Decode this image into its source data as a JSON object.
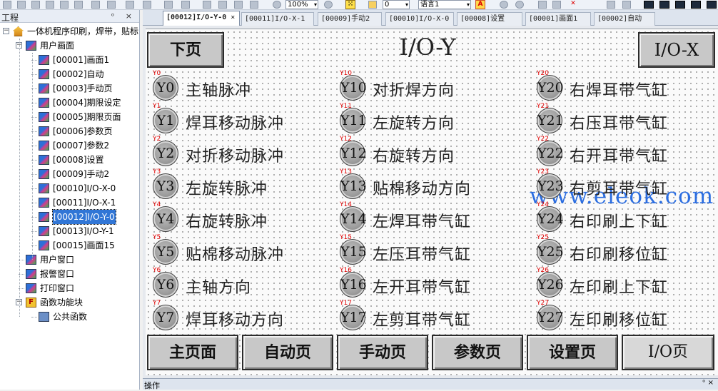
{
  "toolbar": {
    "zoom_value": "100%",
    "number_value": "0",
    "language_value": "语言1"
  },
  "project_panel": {
    "title": "工程",
    "controls": "ᵒ ×",
    "tree": {
      "root": "一体机程序印刷，焊带，贴标",
      "user_screens": "用户画面",
      "screens": [
        "[00001]画面1",
        "[00002]自动",
        "[00003]手动页",
        "[00004]期限设定",
        "[00005]期限页面",
        "[00006]参数页",
        "[00007]参数2",
        "[00008]设置",
        "[00009]手动2",
        "[00010]I/O-X-0",
        "[00011]I/O-X-1",
        "[00012]I/O-Y-0",
        "[00013]I/O-Y-1",
        "[00015]画面15"
      ],
      "selected_index": 11,
      "user_window": "用户窗口",
      "alarm_window": "报警窗口",
      "print_window": "打印窗口",
      "function_block": "函数功能块",
      "public_function": "公共函数"
    }
  },
  "tabs": [
    {
      "label": "[00012]I/O-Y-0",
      "active": true
    },
    {
      "label": "[00011]I/O-X-1"
    },
    {
      "label": "[00009]手动2"
    },
    {
      "label": "[00010]I/O-X-0"
    },
    {
      "label": "[00008]设置"
    },
    {
      "label": "[00001]画面1"
    },
    {
      "label": "[00002]自动"
    }
  ],
  "screen": {
    "title": "I/O-Y",
    "next_page": "下页",
    "io_x": "I/O-X",
    "columns": [
      [
        {
          "tag": "Y0",
          "label": "主轴脉冲"
        },
        {
          "tag": "Y1",
          "label": "焊耳移动脉冲"
        },
        {
          "tag": "Y2",
          "label": "对折移动脉冲"
        },
        {
          "tag": "Y3",
          "label": "左旋转脉冲"
        },
        {
          "tag": "Y4",
          "label": "右旋转脉冲"
        },
        {
          "tag": "Y5",
          "label": "贴棉移动脉冲"
        },
        {
          "tag": "Y6",
          "label": "主轴方向"
        },
        {
          "tag": "Y7",
          "label": "焊耳移动方向"
        }
      ],
      [
        {
          "tag": "Y10",
          "label": "对折焊方向"
        },
        {
          "tag": "Y11",
          "label": "左旋转方向"
        },
        {
          "tag": "Y12",
          "label": "右旋转方向"
        },
        {
          "tag": "Y13",
          "label": "贴棉移动方向"
        },
        {
          "tag": "Y14",
          "label": "左焊耳带气缸"
        },
        {
          "tag": "Y15",
          "label": "左压耳带气缸"
        },
        {
          "tag": "Y16",
          "label": "左开耳带气缸"
        },
        {
          "tag": "Y17",
          "label": "左剪耳带气缸"
        }
      ],
      [
        {
          "tag": "Y20",
          "label": "右焊耳带气缸"
        },
        {
          "tag": "Y21",
          "label": "右压耳带气缸"
        },
        {
          "tag": "Y22",
          "label": "右开耳带气缸"
        },
        {
          "tag": "Y23",
          "label": "右剪耳带气缸"
        },
        {
          "tag": "Y24",
          "label": "右印刷上下缸"
        },
        {
          "tag": "Y25",
          "label": "右印刷移位缸"
        },
        {
          "tag": "Y26",
          "label": "左印刷上下缸"
        },
        {
          "tag": "Y27",
          "label": "左印刷移位缸"
        }
      ]
    ],
    "nav_buttons": [
      "主页面",
      "自动页",
      "手动页",
      "参数页",
      "设置页",
      "I/O页"
    ],
    "watermark": "www.eleok.com"
  },
  "status": {
    "label": "操作",
    "controls": "ᵒ ×"
  },
  "colors": {
    "tag_red": "#e00000",
    "watermark_blue": "#2b6de0",
    "selection_blue": "#3176d6"
  }
}
